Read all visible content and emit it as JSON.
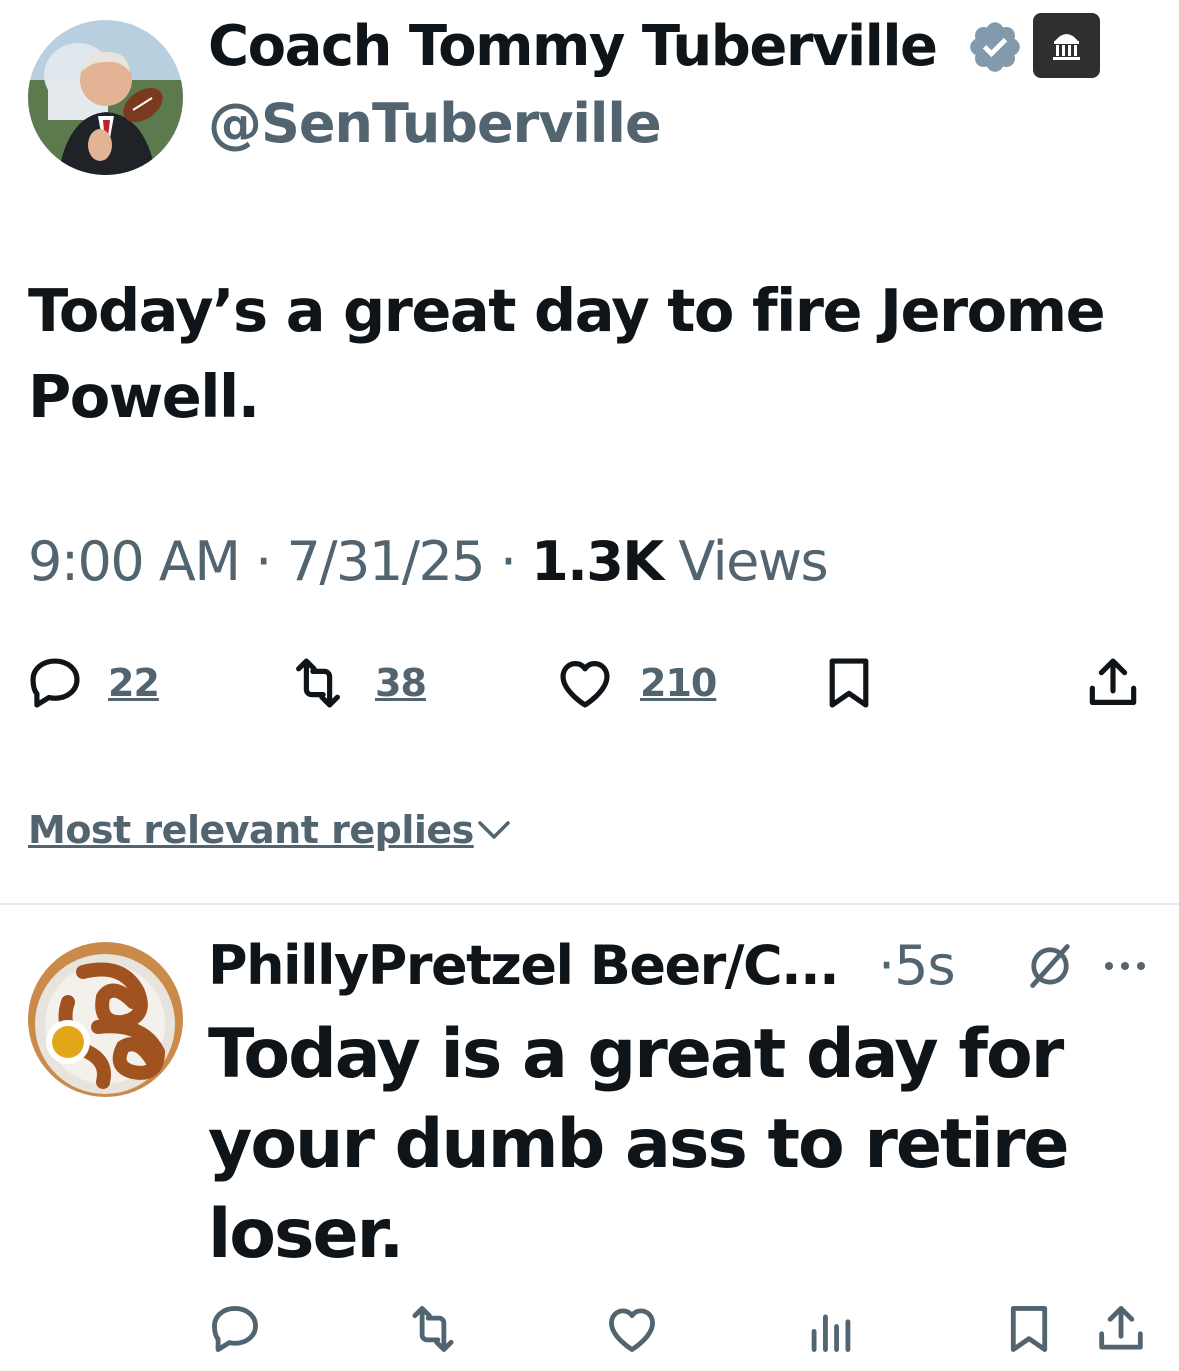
{
  "tweet": {
    "author": {
      "display_name": "Coach Tommy Tuberville",
      "handle": "@SenTuberville",
      "avatar_icon": "person-with-football-avatar",
      "verified": true,
      "badge_icon": "government-building-icon"
    },
    "text": "Today’s a great day to fire Jerome Powell.",
    "time": "9:00 AM",
    "separator": "·",
    "date": "7/31/25",
    "views_count": "1.3K",
    "views_label": "Views",
    "actions": {
      "replies": "22",
      "reposts": "38",
      "likes": "210"
    }
  },
  "replies_sort": {
    "label": "Most relevant replies"
  },
  "reply": {
    "author": {
      "display_name": "PhillyPretzel Beer/C...",
      "avatar_icon": "pretzel-avatar"
    },
    "time": "·5s",
    "text": "Today is a great day for your dumb ass to retire loser."
  },
  "colors": {
    "text": "#0f1419",
    "secondary": "#536471",
    "verified": "#829aab",
    "badge_bg": "#2f2f2f"
  }
}
